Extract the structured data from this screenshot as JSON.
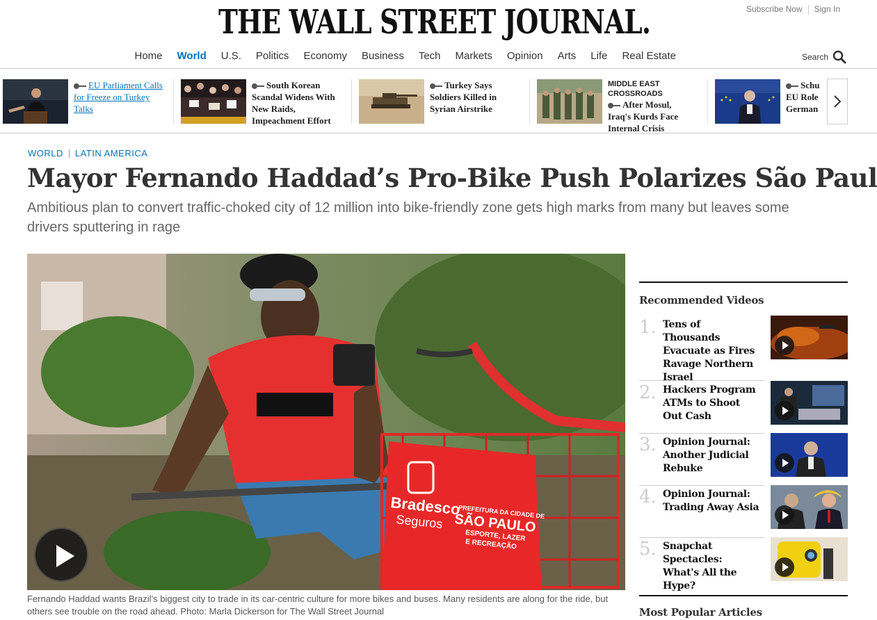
{
  "masthead": {
    "logo": "THE WALL STREET JOURNAL.",
    "subscribe": "Subscribe Now",
    "signin": "Sign In",
    "search_label": "Search"
  },
  "nav": {
    "items": [
      "Home",
      "World",
      "U.S.",
      "Politics",
      "Economy",
      "Business",
      "Tech",
      "Markets",
      "Opinion",
      "Arts",
      "Life",
      "Real Estate"
    ],
    "active": "World"
  },
  "ticker": [
    {
      "kicker": "",
      "title": "EU Parliament Calls for Freeze on Turkey Talks",
      "keyed": true,
      "link": true
    },
    {
      "kicker": "",
      "title": "South Korean Scandal Widens With New Raids, Impeachment Effort",
      "keyed": true,
      "link": false
    },
    {
      "kicker": "",
      "title": "Turkey Says Soldiers Killed in Syrian Airstrike",
      "keyed": true,
      "link": false
    },
    {
      "kicker": "MIDDLE EAST CROSSROADS",
      "title": "After Mosul, Iraq's Kurds Face Internal Crisis",
      "keyed": true,
      "link": false
    },
    {
      "kicker": "",
      "title": "Schu EU Role German",
      "keyed": true,
      "link": false
    }
  ],
  "article": {
    "section": "WORLD",
    "subsection": "LATIN AMERICA",
    "headline": "Mayor Fernando Haddad’s Pro-Bike Push Polarizes São Paulo",
    "dek": "Ambitious plan to convert traffic-choked city of 12 million into bike-friendly zone gets high marks from many but leaves some drivers sputtering in rage",
    "caption": "Fernando Haddad wants Brazil’s biggest city to trade in its car-centric culture for more bikes and buses. Many residents are along for the ride, but others see trouble on the road ahead. Photo: Marla Dickerson for The Wall Street Journal",
    "photo_text": {
      "brand": "Bradesco",
      "brand_sub": "Seguros",
      "city_top": "PREFEITURA DA CIDADE DE",
      "city": "SÃO PAULO",
      "city_sub1": "ESPORTE, LAZER",
      "city_sub2": "E RECREAÇÃO"
    }
  },
  "sidebar": {
    "title": "Recommended Videos",
    "videos": [
      {
        "num": "1.",
        "title": "Tens of Thousands Evacuate as Fires Ravage Northern Israel"
      },
      {
        "num": "2.",
        "title": "Hackers Program ATMs to Shoot Out Cash"
      },
      {
        "num": "3.",
        "title": "Opinion Journal: Another Judicial Rebuke"
      },
      {
        "num": "4.",
        "title": "Opinion Journal: Trading Away Asia"
      },
      {
        "num": "5.",
        "title": "Snapchat Spectacles: What's All the Hype?"
      }
    ],
    "popular_title": "Most Popular Articles"
  }
}
